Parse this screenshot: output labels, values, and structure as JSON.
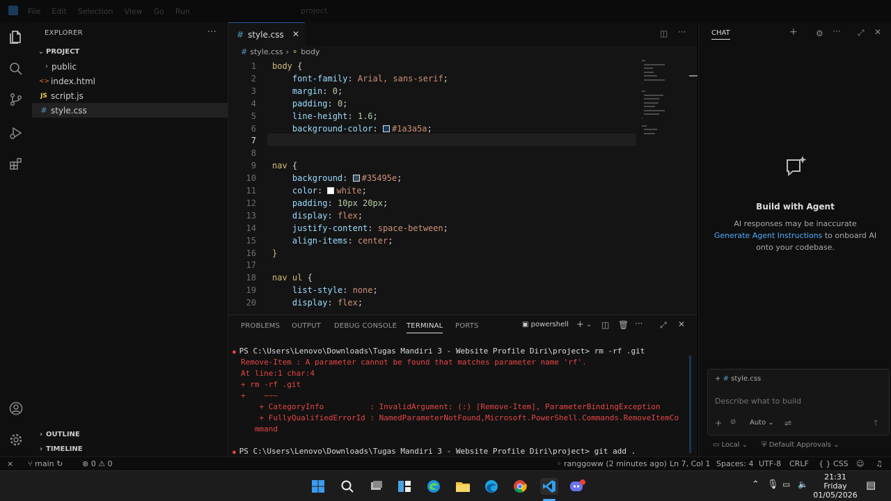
{
  "titlebar": {
    "menu": [
      "File",
      "Edit",
      "Selection",
      "View",
      "Go",
      "Run"
    ],
    "title": "project"
  },
  "sidebar": {
    "header": "EXPLORER",
    "more": "···",
    "root": "PROJECT",
    "items": [
      {
        "label": "public",
        "type": "folder"
      },
      {
        "label": "index.html",
        "type": "html",
        "icon": "<>"
      },
      {
        "label": "script.js",
        "type": "js",
        "icon": "JS"
      },
      {
        "label": "style.css",
        "type": "css",
        "icon": "#"
      }
    ],
    "outline": "OUTLINE",
    "timeline": "TIMELINE"
  },
  "editor": {
    "tab": {
      "icon": "#",
      "label": "style.css"
    },
    "breadcrumb": {
      "file": "style.css",
      "symbol": "body"
    },
    "lines": [
      {
        "n": "1",
        "parts": [
          [
            "sel",
            "body"
          ],
          [
            "punc",
            " {"
          ]
        ]
      },
      {
        "n": "2",
        "parts": [
          [
            "punc",
            "    "
          ],
          [
            "prop",
            "font-family"
          ],
          [
            "punc",
            ": "
          ],
          [
            "val",
            "Arial, sans-serif"
          ],
          [
            "punc",
            ";"
          ]
        ]
      },
      {
        "n": "3",
        "parts": [
          [
            "punc",
            "    "
          ],
          [
            "prop",
            "margin"
          ],
          [
            "punc",
            ": "
          ],
          [
            "num",
            "0"
          ],
          [
            "punc",
            ";"
          ]
        ]
      },
      {
        "n": "4",
        "parts": [
          [
            "punc",
            "    "
          ],
          [
            "prop",
            "padding"
          ],
          [
            "punc",
            ": "
          ],
          [
            "num",
            "0"
          ],
          [
            "punc",
            ";"
          ]
        ]
      },
      {
        "n": "5",
        "parts": [
          [
            "punc",
            "    "
          ],
          [
            "prop",
            "line-height"
          ],
          [
            "punc",
            ": "
          ],
          [
            "num",
            "1.6"
          ],
          [
            "punc",
            ";"
          ]
        ]
      },
      {
        "n": "6",
        "parts": [
          [
            "punc",
            "    "
          ],
          [
            "prop",
            "background-color"
          ],
          [
            "punc",
            ": "
          ],
          [
            "swatch",
            "#1a3a5a"
          ],
          [
            "val",
            "#1a3a5a"
          ],
          [
            "punc",
            ";"
          ]
        ]
      },
      {
        "n": "7",
        "parts": [
          [
            "sel",
            "}"
          ]
        ]
      },
      {
        "n": "8",
        "parts": []
      },
      {
        "n": "9",
        "parts": [
          [
            "sel",
            "nav"
          ],
          [
            "punc",
            " {"
          ]
        ]
      },
      {
        "n": "10",
        "parts": [
          [
            "punc",
            "    "
          ],
          [
            "prop",
            "background"
          ],
          [
            "punc",
            ": "
          ],
          [
            "swatch",
            "#35495e"
          ],
          [
            "val",
            "#35495e"
          ],
          [
            "punc",
            ";"
          ]
        ]
      },
      {
        "n": "11",
        "parts": [
          [
            "punc",
            "    "
          ],
          [
            "prop",
            "color"
          ],
          [
            "punc",
            ": "
          ],
          [
            "swatch",
            "#ffffff"
          ],
          [
            "val",
            "white"
          ],
          [
            "punc",
            ";"
          ]
        ]
      },
      {
        "n": "12",
        "parts": [
          [
            "punc",
            "    "
          ],
          [
            "prop",
            "padding"
          ],
          [
            "punc",
            ": "
          ],
          [
            "num",
            "10px 20px"
          ],
          [
            "punc",
            ";"
          ]
        ]
      },
      {
        "n": "13",
        "parts": [
          [
            "punc",
            "    "
          ],
          [
            "prop",
            "display"
          ],
          [
            "punc",
            ": "
          ],
          [
            "val",
            "flex"
          ],
          [
            "punc",
            ";"
          ]
        ]
      },
      {
        "n": "14",
        "parts": [
          [
            "punc",
            "    "
          ],
          [
            "prop",
            "justify-content"
          ],
          [
            "punc",
            ": "
          ],
          [
            "val",
            "space-between"
          ],
          [
            "punc",
            ";"
          ]
        ]
      },
      {
        "n": "15",
        "parts": [
          [
            "punc",
            "    "
          ],
          [
            "prop",
            "align-items"
          ],
          [
            "punc",
            ": "
          ],
          [
            "val",
            "center"
          ],
          [
            "punc",
            ";"
          ]
        ]
      },
      {
        "n": "16",
        "parts": [
          [
            "sel",
            "}"
          ]
        ]
      },
      {
        "n": "17",
        "parts": []
      },
      {
        "n": "18",
        "parts": [
          [
            "sel",
            "nav ul"
          ],
          [
            "punc",
            " {"
          ]
        ]
      },
      {
        "n": "19",
        "parts": [
          [
            "punc",
            "    "
          ],
          [
            "prop",
            "list-style"
          ],
          [
            "punc",
            ": "
          ],
          [
            "val",
            "none"
          ],
          [
            "punc",
            ";"
          ]
        ]
      },
      {
        "n": "20",
        "parts": [
          [
            "punc",
            "    "
          ],
          [
            "prop",
            "display"
          ],
          [
            "punc",
            ": "
          ],
          [
            "val",
            "flex"
          ],
          [
            "punc",
            ";"
          ]
        ]
      }
    ],
    "current_line": "7"
  },
  "panel": {
    "tabs": [
      "PROBLEMS",
      "OUTPUT",
      "DEBUG CONSOLE",
      "TERMINAL",
      "PORTS"
    ],
    "active_tab": "TERMINAL",
    "shell": "powershell",
    "terminal": [
      {
        "cls": "ok",
        "text": "PS C:\\Users\\Lenovo\\Downloads\\Tugas Mandiri 3 - Website Profile Diri\\project> rm -rf .git"
      },
      {
        "cls": "err",
        "text": "Remove-Item : A parameter cannot be found that matches parameter name 'rf'."
      },
      {
        "cls": "err",
        "text": "At line:1 char:4"
      },
      {
        "cls": "err",
        "text": "+ rm -rf .git"
      },
      {
        "cls": "err",
        "text": "+    ~~~"
      },
      {
        "cls": "err",
        "text": "    + CategoryInfo          : InvalidArgument: (:) [Remove-Item], ParameterBindingException"
      },
      {
        "cls": "err",
        "text": "    + FullyQualifiedErrorId : NamedParameterNotFound,Microsoft.PowerShell.Commands.RemoveItemCo"
      },
      {
        "cls": "err",
        "text": "   mmand"
      },
      {
        "cls": "ok",
        "text": " "
      },
      {
        "cls": "ok",
        "text": "PS C:\\Users\\Lenovo\\Downloads\\Tugas Mandiri 3 - Website Profile Diri\\project> git add ."
      }
    ]
  },
  "chat": {
    "header": "CHAT",
    "title": "Build with Agent",
    "line1": "AI responses may be inaccurate",
    "link": "Generate Agent Instructions",
    "line2_tail": " to onboard AI",
    "line3": "onto your codebase.",
    "context_file": "style.css",
    "placeholder": "Describe what to build",
    "mode": "Auto",
    "local": "Local",
    "approvals": "Default Approvals"
  },
  "status": {
    "branch": "main",
    "errors": "0",
    "warnings": "0",
    "blame": "ranggoww (2 minutes ago)",
    "position": "Ln 7, Col 1",
    "spaces": "Spaces: 4",
    "encoding": "UTF-8",
    "eol": "CRLF",
    "language": "CSS"
  },
  "taskbar": {
    "time": "21:31",
    "day": "Friday",
    "date": "01/05/2026"
  }
}
